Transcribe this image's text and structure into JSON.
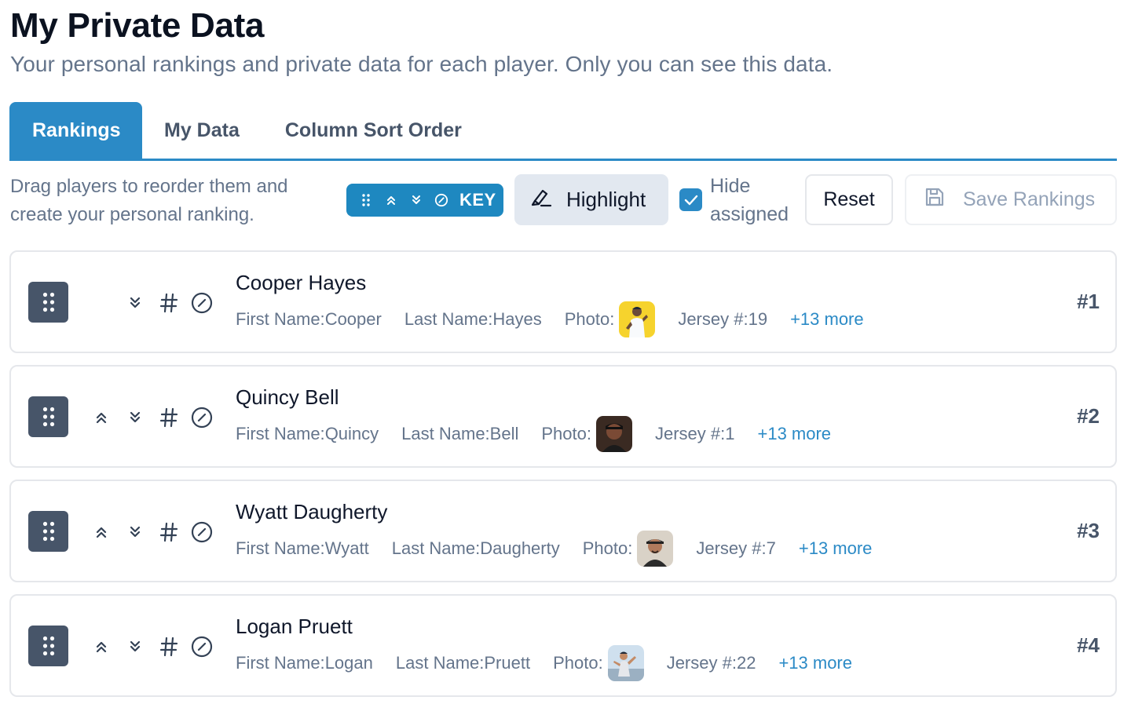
{
  "header": {
    "title": "My Private Data",
    "subtitle": "Your personal rankings and private data for each player. Only you can see this data."
  },
  "tabs": [
    {
      "label": "Rankings",
      "active": true
    },
    {
      "label": "My Data",
      "active": false
    },
    {
      "label": "Column Sort Order",
      "active": false
    }
  ],
  "toolbar": {
    "instructions": "Drag players to reorder them and create your personal ranking.",
    "key_label": "KEY",
    "key_icons": [
      "drag-dots-icon",
      "chevron-double-up-icon",
      "chevron-double-down-icon",
      "ban-icon"
    ],
    "highlight_label": "Highlight",
    "hide_assigned_label": "Hide assigned",
    "hide_assigned_checked": true,
    "reset_label": "Reset",
    "save_label": "Save Rankings"
  },
  "players": [
    {
      "name": "Cooper Hayes",
      "first_label": "First Name:",
      "first": "Cooper",
      "last_label": "Last Name:",
      "last": "Hayes",
      "photo_label": "Photo:",
      "jersey_label": "Jersey #:",
      "jersey": "19",
      "more": "+13 more",
      "rank": "#1",
      "show_up": false
    },
    {
      "name": "Quincy Bell",
      "first_label": "First Name:",
      "first": "Quincy",
      "last_label": "Last Name:",
      "last": "Bell",
      "photo_label": "Photo:",
      "jersey_label": "Jersey #:",
      "jersey": "1",
      "more": "+13 more",
      "rank": "#2",
      "show_up": true
    },
    {
      "name": "Wyatt Daugherty",
      "first_label": "First Name:",
      "first": "Wyatt",
      "last_label": "Last Name:",
      "last": "Daugherty",
      "photo_label": "Photo:",
      "jersey_label": "Jersey #:",
      "jersey": "7",
      "more": "+13 more",
      "rank": "#3",
      "show_up": true
    },
    {
      "name": "Logan Pruett",
      "first_label": "First Name:",
      "first": "Logan",
      "last_label": "Last Name:",
      "last": "Pruett",
      "photo_label": "Photo:",
      "jersey_label": "Jersey #:",
      "jersey": "22",
      "more": "+13 more",
      "rank": "#4",
      "show_up": true
    }
  ],
  "colors": {
    "accent": "#2b8ac6",
    "drag_handle": "#475569",
    "muted_text": "#64748b"
  }
}
